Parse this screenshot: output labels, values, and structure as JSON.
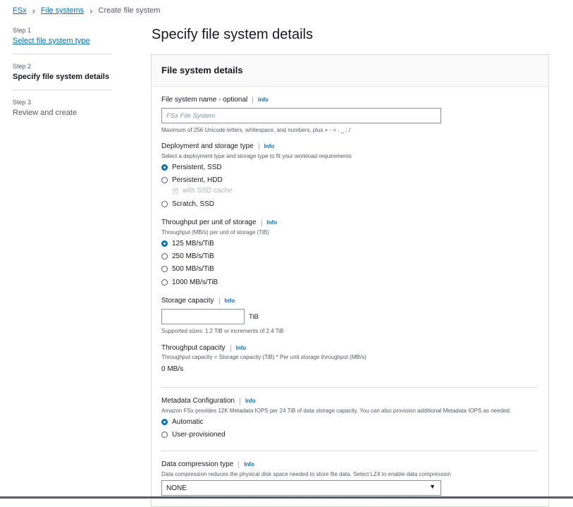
{
  "breadcrumb": {
    "items": [
      "FSx",
      "File systems"
    ],
    "current": "Create file system"
  },
  "steps": [
    {
      "label": "Step 1",
      "title": "Select file system type"
    },
    {
      "label": "Step 2",
      "title": "Specify file system details"
    },
    {
      "label": "Step 3",
      "title": "Review and create"
    }
  ],
  "page_title": "Specify file system details",
  "panel": {
    "title": "File system details",
    "info_label": "Info",
    "name_field": {
      "label": "File system name - optional",
      "placeholder": "FSx File System",
      "value": "",
      "hint": "Maximum of 256 Unicode letters, whitespace, and numbers, plus + - = . _ : /"
    },
    "deployment": {
      "label": "Deployment and storage type",
      "desc": "Select a deployment type and storage type to fit your workload requirements",
      "options": [
        "Persistent, SSD",
        "Persistent, HDD",
        "Scratch, SSD"
      ],
      "selected": "Persistent, SSD",
      "ssd_cache_label": "with SSD cache"
    },
    "throughput_unit": {
      "label": "Throughput per unit of storage",
      "desc": "Throughput (MB/s) per unit of storage (TiB)",
      "options": [
        "125 MB/s/TiB",
        "250 MB/s/TiB",
        "500 MB/s/TiB",
        "1000 MB/s/TiB"
      ],
      "selected": "125 MB/s/TiB"
    },
    "storage_capacity": {
      "label": "Storage capacity",
      "value": "",
      "unit": "TiB",
      "hint": "Supported sizes: 1.2 TiB or increments of 2.4 TiB"
    },
    "throughput_capacity": {
      "label": "Throughput capacity",
      "desc": "Throughput capacity = Storage capacity (TiB) * Per unit storage throughput (MB/s)",
      "value": "0 MB/s"
    },
    "metadata": {
      "label": "Metadata Configuration",
      "desc": "Amazon FSx provides 12K Metadata IOPS per 24 TiB of data storage capacity. You can also provision additional Metadata IOPS as needed.",
      "options": [
        "Automatic",
        "User-provisioned"
      ],
      "selected": "Automatic"
    },
    "compression": {
      "label": "Data compression type",
      "desc": "Data compression reduces the physical disk space needed to store file data. Select LZ4 to enable data compression",
      "selected": "NONE"
    }
  },
  "colors": {
    "accent": "#0073bb",
    "text": "#16191f",
    "muted": "#545b64",
    "border": "#d5dbdb"
  },
  "icons": {
    "breadcrumb_separator": "chevron-right-icon",
    "select_arrow": "caret-down-icon"
  }
}
